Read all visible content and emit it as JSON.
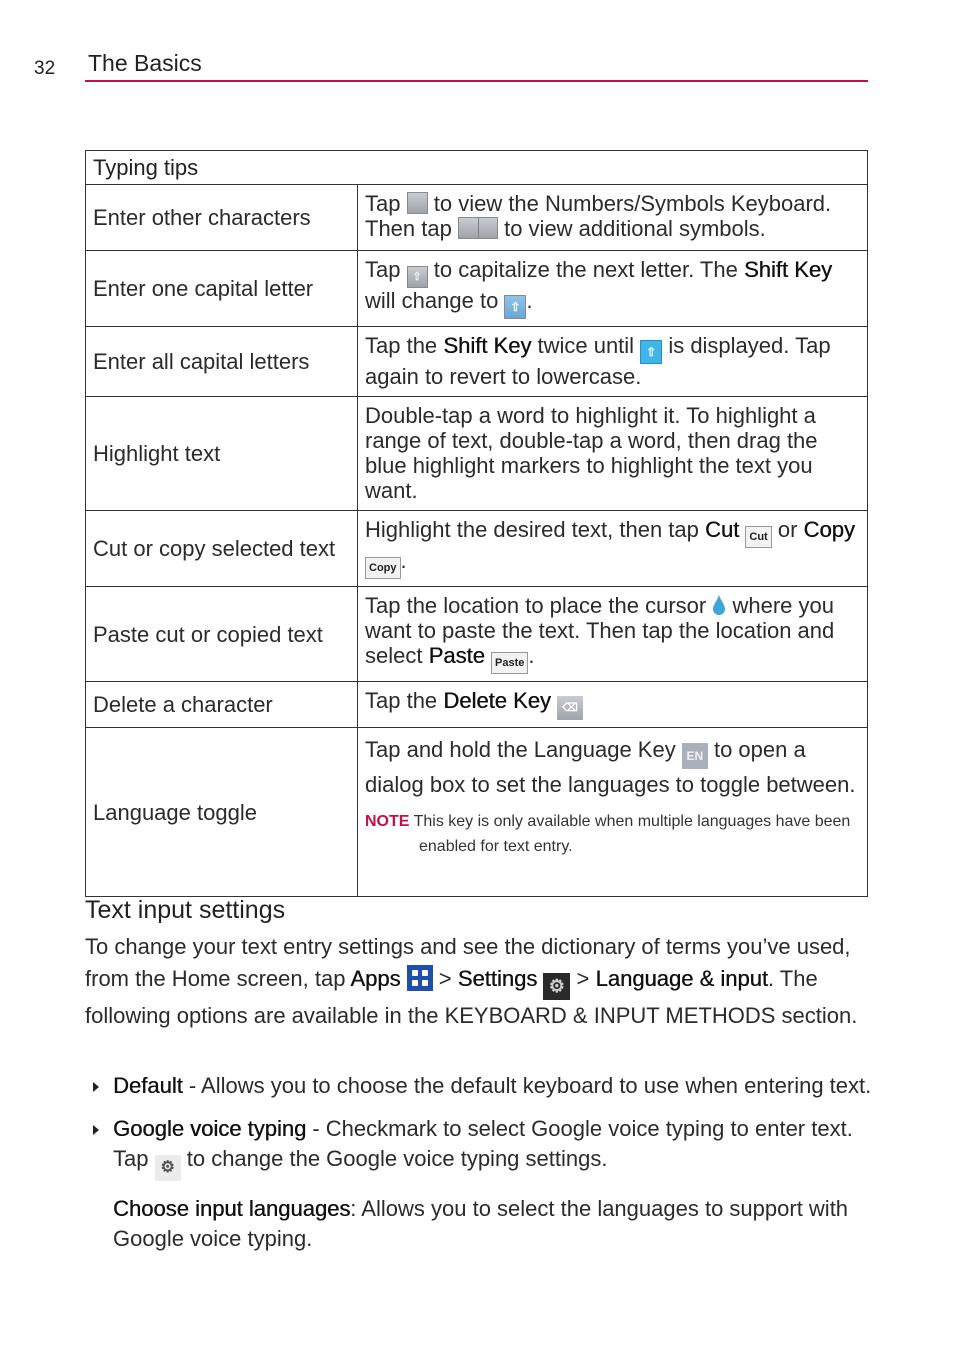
{
  "header": {
    "page_number": "32",
    "section": "The Basics",
    "accent_color": "#c0104f"
  },
  "table": {
    "title": "Typing tips",
    "rows": [
      {
        "label": "Enter other characters",
        "parts": [
          "Tap",
          "to view the Numbers/Symbols Keyboard. Then tap",
          "to view additional symbols."
        ],
        "icons": [
          "numbers-symbols-key-icon",
          "arrow-keys-icon"
        ]
      },
      {
        "label": "Enter one capital letter",
        "parts": [
          "Tap",
          "to capitalize the next letter. The",
          "Shift Key",
          "will change to",
          "."
        ],
        "icons": [
          "shift-key-icon",
          "shift-key-active-icon"
        ]
      },
      {
        "label": "Enter all capital letters",
        "parts": [
          "Tap the",
          "Shift Key",
          "twice until",
          "is displayed. Tap again to revert to lowercase."
        ],
        "icons": [
          "caps-lock-icon"
        ]
      },
      {
        "label": "Highlight text",
        "parts": [
          "Double-tap a word to highlight it. To highlight a range of text, double-tap a word, then drag the blue highlight markers to highlight the text you want."
        ]
      },
      {
        "label": "Cut or copy selected text",
        "parts": [
          "Highlight the desired text, then tap",
          "Cut",
          "or",
          "Copy",
          "."
        ],
        "icons": [
          "Cut",
          "Copy"
        ]
      },
      {
        "label": "Paste cut or copied text",
        "parts": [
          "Tap the location to place the cursor",
          "where you want to paste the text. Then tap the location and select",
          "Paste",
          "."
        ],
        "icons": [
          "cursor-marker-icon",
          "Paste"
        ]
      },
      {
        "label": "Delete a character",
        "parts": [
          "Tap the",
          "Delete Key"
        ],
        "icons": [
          "delete-key-icon"
        ]
      },
      {
        "label": "Language toggle",
        "parts": [
          "Tap and hold the Language Key",
          "to open a dialog box to set the languages to toggle between."
        ],
        "icons": [
          "EN"
        ],
        "note_label": "NOTE",
        "note_text": "This key is only available when multiple languages have been enabled for text entry."
      }
    ]
  },
  "text_input": {
    "heading": "Text input settings",
    "intro_parts": [
      "To change your text entry settings and see the dictionary of terms you’ve used, from the Home screen, tap",
      "Apps",
      ">",
      "Settings",
      ">",
      "Language & input",
      ". The following options are available in the KEYBOARD & INPUT METHODS section."
    ],
    "bullets": [
      {
        "term": "Default",
        "text": " - Allows you to choose the default keyboard to use when entering text."
      },
      {
        "term": "Google voice typing",
        "text": " - Checkmark to select Google voice typing to enter text. Tap",
        "text2": "to change the Google voice typing settings."
      }
    ],
    "sub_item": {
      "term": "Choose input languages",
      "text": ": Allows you to select the languages to support with Google voice typing."
    }
  }
}
